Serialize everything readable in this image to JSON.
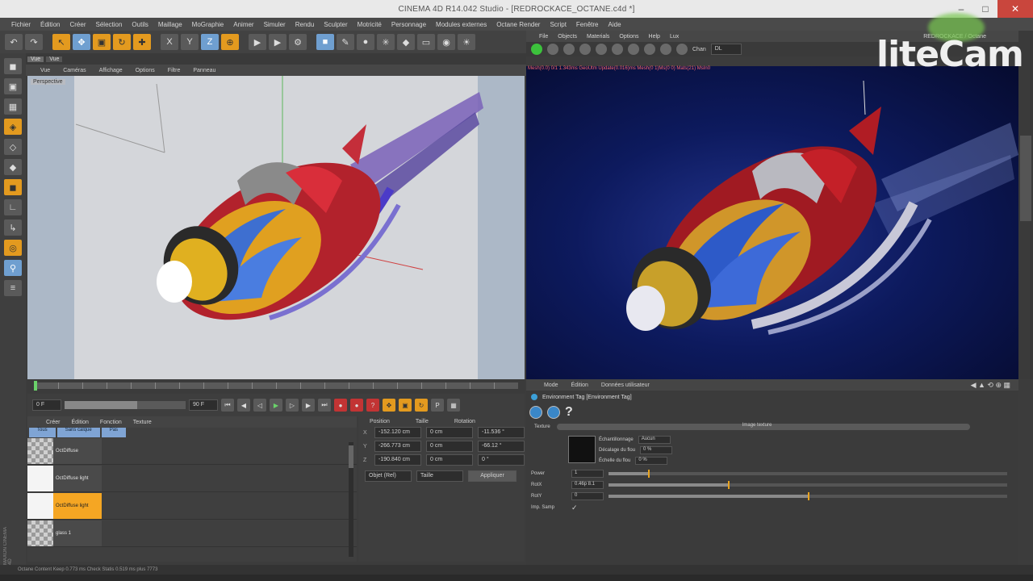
{
  "window": {
    "title": "CINEMA 4D R14.042 Studio - [REDROCKACE_OCTANE.c4d *]"
  },
  "menubar": [
    "Fichier",
    "Édition",
    "Créer",
    "Sélection",
    "Outils",
    "Maillage",
    "MoGraphie",
    "Animer",
    "Simuler",
    "Rendu",
    "Sculpter",
    "Motricité",
    "Personnage",
    "Modules externes",
    "Octane Render",
    "Script",
    "Fenêtre",
    "Aide"
  ],
  "viewport": {
    "tabs": [
      "Vue",
      "Vue"
    ],
    "menu": [
      "Vue",
      "Caméras",
      "Affichage",
      "Options",
      "Filtre",
      "Panneau"
    ],
    "label": "Perspective"
  },
  "transport": {
    "start_frame": "0 F",
    "end_frame": "90 F"
  },
  "materials": {
    "menu": [
      "Créer",
      "Édition",
      "Fonction",
      "Texture"
    ],
    "tabs": [
      "Tous",
      "Sans calque",
      "Pas"
    ],
    "items": [
      {
        "name": "OctDiffuse",
        "selected": false,
        "thumb": "checker"
      },
      {
        "name": "OctDiffuse light",
        "selected": false,
        "thumb": "white"
      },
      {
        "name": "OctDiffuse light",
        "selected": true,
        "thumb": "white"
      },
      {
        "name": "glass 1",
        "selected": false,
        "thumb": "checker"
      }
    ]
  },
  "coordinates": {
    "headers": [
      "Position",
      "Taille",
      "Rotation"
    ],
    "rows": [
      {
        "axis": "X",
        "pos": "-152.120 cm",
        "size": "0 cm",
        "rot": "-11.536 °"
      },
      {
        "axis": "Y",
        "pos": "-266.773 cm",
        "size": "0 cm",
        "rot": "-66.12 °"
      },
      {
        "axis": "Z",
        "pos": "-190.840 cm",
        "size": "0 cm",
        "rot": "0 °"
      }
    ],
    "mode_object": "Objet (Rel)",
    "mode_size": "Taille",
    "apply_label": "Appliquer"
  },
  "renderer": {
    "menu": [
      "File",
      "Objects",
      "Materials",
      "Options",
      "Help",
      "Lux"
    ],
    "channel_label": "Chan",
    "channel_value": "DL",
    "status_text": "Mesh(0.0) 0/1 1.343ms  GeoUtm  Update(0.016)ms  Mesh(0 1)Ms(0 0)  Mats(21)  MsIn0",
    "tab_right": "REDROCKACE / Octane"
  },
  "attributes": {
    "tabs": [
      "Mode",
      "Édition",
      "Données utilisateur"
    ],
    "title": "Environment Tag [Environment Tag]",
    "texture_label": "Texture",
    "image_texture": "Image texture",
    "props": [
      {
        "label": "Échantillonnage",
        "value": "Aucun"
      },
      {
        "label": "Décalage du flou",
        "value": "0 %"
      },
      {
        "label": "Échelle du flou",
        "value": "0 %"
      }
    ],
    "params": [
      {
        "label": "Power",
        "value": "1",
        "fill": 0.1
      },
      {
        "label": "RotX",
        "value": "0.46p 8.1",
        "fill": 0.3
      },
      {
        "label": "RotY",
        "value": "0",
        "fill": 0.5
      },
      {
        "label": "Imp. Samp",
        "value": "✓",
        "fill": 0
      }
    ]
  },
  "statusbar": "Octane Content Keep 0.773 ms  Check Statis 0.519 ms  plus 7773",
  "brand_vertical": "MAXON CINEMA 4D",
  "watermark": "liteCam",
  "colors": {
    "accent_orange": "#f5a623",
    "render_bg": "#0d1a5e",
    "viewport_bg": "#d4d6da",
    "selection_blue": "#7fa4d4"
  }
}
